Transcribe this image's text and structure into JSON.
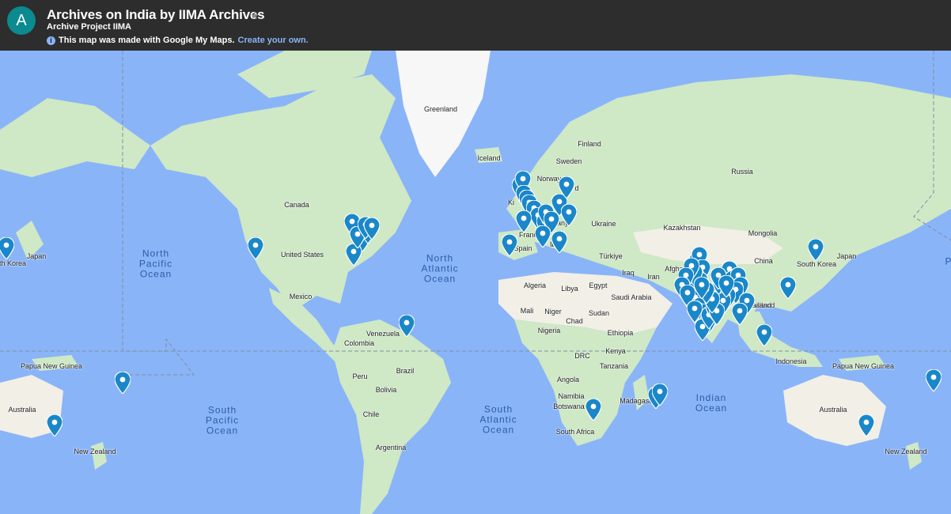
{
  "header": {
    "avatar_letter": "A",
    "title": "Archives on India by IIMA Archives",
    "subtitle": "Archive Project IIMA",
    "notice_text": "This map was made with Google My Maps.",
    "notice_link": "Create your own."
  },
  "colors": {
    "header_bg": "#2d2d2d",
    "avatar_bg": "#0b8a8f",
    "ocean": "#8ab4f8",
    "land": "#cfe8c6",
    "desert": "#f1efe6",
    "pin": "#1a87c9",
    "link": "#8ab4f8"
  },
  "map": {
    "labels": [
      "Greenland",
      "Iceland",
      "Finland",
      "Sweden",
      "Norway",
      "Russia",
      "Canada",
      "United States",
      "Mexico",
      "Kazakhstan",
      "Mongolia",
      "China",
      "Japan",
      "South Korea",
      "Türkiye",
      "Ukraine",
      "Iraq",
      "Iran",
      "Afgha",
      "Algeria",
      "Libya",
      "Egypt",
      "Saudi Arabia",
      "Mali",
      "Niger",
      "Chad",
      "Sudan",
      "Nigeria",
      "Ethiopia",
      "DRC",
      "Kenya",
      "Tanzania",
      "Angola",
      "Namibia",
      "Botswana",
      "South Africa",
      "Madagascar",
      "Venezuela",
      "Colombia",
      "Peru",
      "Brazil",
      "Bolivia",
      "Chile",
      "Argentina",
      "Indonesia",
      "Thailand",
      "Papua New Guinea",
      "Australia",
      "New Zealand",
      "Spain",
      "France",
      "Italy",
      "Germany",
      "Japan",
      "th Korea",
      "Papua New Guinea",
      "Australia",
      "New Zealand",
      "Ki",
      "d",
      "Ital",
      "ailand"
    ],
    "oceans": [
      "North\nPacific\nOcean",
      "North\nAtlantic\nOcean",
      "South\nPacific\nOcean",
      "South\nAtlantic\nOcean",
      "Indian\nOcean",
      "P"
    ],
    "pin_count": 75
  }
}
